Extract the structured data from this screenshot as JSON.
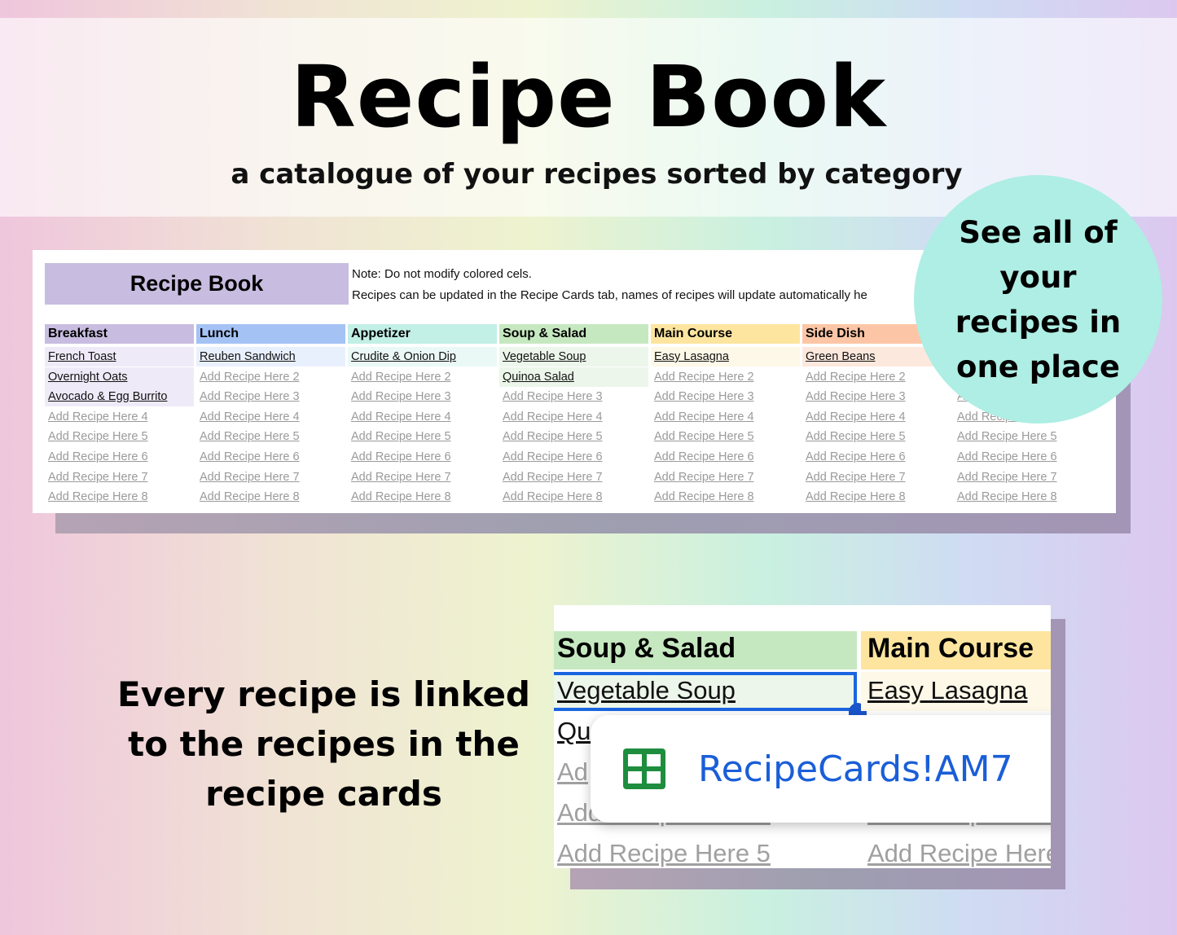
{
  "hero": {
    "title": "Recipe Book",
    "subtitle": "a catalogue of your recipes sorted by category"
  },
  "sheet": {
    "title": "Recipe Book",
    "note_line1": "Note: Do not modify colored cels.",
    "note_line2": "Recipes can be updated in the Recipe Cards tab, names of recipes will update automatically he",
    "columns": [
      {
        "header": "Breakfast",
        "header_color": "#c8bde0",
        "fill_color": "#efeaf8",
        "items": [
          "French Toast",
          "Overnight Oats",
          "Avocado & Egg Burrito",
          "Add Recipe Here 4",
          "Add Recipe Here 5",
          "Add Recipe Here 6",
          "Add Recipe Here 7",
          "Add Recipe Here 8"
        ],
        "filled": 3
      },
      {
        "header": "Lunch",
        "header_color": "#a4c2f4",
        "fill_color": "#e9f0fd",
        "items": [
          "Reuben Sandwich",
          "Add Recipe Here 2",
          "Add Recipe Here 3",
          "Add Recipe Here 4",
          "Add Recipe Here 5",
          "Add Recipe Here 6",
          "Add Recipe Here 7",
          "Add Recipe Here 8"
        ],
        "filled": 1
      },
      {
        "header": "Appetizer",
        "header_color": "#c2efe6",
        "fill_color": "#eaf9f6",
        "items": [
          "Crudite & Onion Dip",
          "Add Recipe Here 2",
          "Add Recipe Here 3",
          "Add Recipe Here 4",
          "Add Recipe Here 5",
          "Add Recipe Here 6",
          "Add Recipe Here 7",
          "Add Recipe Here 8"
        ],
        "filled": 1
      },
      {
        "header": "Soup & Salad",
        "header_color": "#c6e8c0",
        "fill_color": "#ecf6ea",
        "items": [
          "Vegetable Soup",
          "Quinoa Salad",
          "Add Recipe Here 3",
          "Add Recipe Here 4",
          "Add Recipe Here 5",
          "Add Recipe Here 6",
          "Add Recipe Here 7",
          "Add Recipe Here 8"
        ],
        "filled": 2
      },
      {
        "header": "Main Course",
        "header_color": "#fde59f",
        "fill_color": "#fef8e8",
        "items": [
          "Easy Lasagna",
          "Add Recipe Here 2",
          "Add Recipe Here 3",
          "Add Recipe Here 4",
          "Add Recipe Here 5",
          "Add Recipe Here 6",
          "Add Recipe Here 7",
          "Add Recipe Here 8"
        ],
        "filled": 1
      },
      {
        "header": "Side Dish",
        "header_color": "#fcc6a6",
        "fill_color": "#fde8dd",
        "items": [
          "Green Beans",
          "Add Recipe Here 2",
          "Add Recipe Here 3",
          "Add Recipe Here 4",
          "Add Recipe Here 5",
          "Add Recipe Here 6",
          "Add Recipe Here 7",
          "Add Recipe Here 8"
        ],
        "filled": 1
      },
      {
        "header": "",
        "header_color": "#ffffff",
        "fill_color": "#ffffff",
        "items": [
          "",
          "",
          "Add Recipe Here 3",
          "Add Recipe Here 4",
          "Add Recipe Here 5",
          "Add Recipe Here 6",
          "Add Recipe Here 7",
          "Add Recipe Here 8"
        ],
        "filled": 0
      }
    ]
  },
  "callout": {
    "text": "See all of your recipes in one place"
  },
  "caption": {
    "text": "Every recipe is linked to the recipes in the recipe cards"
  },
  "inset": {
    "col1": {
      "header": "Soup & Salad",
      "items": [
        "Vegetable Soup",
        "Qu",
        "Ad",
        "Add Recipe Here 4",
        "Add Recipe Here 5"
      ]
    },
    "col2": {
      "header": "Main Course",
      "items": [
        "Easy Lasagna",
        "",
        "",
        "Add Recipe Here 4",
        "Add Recipe Here"
      ]
    },
    "link_popup": {
      "icon": "google-sheets-icon",
      "text": "RecipeCards!AM7",
      "link_color": "#1a5ed8"
    }
  }
}
